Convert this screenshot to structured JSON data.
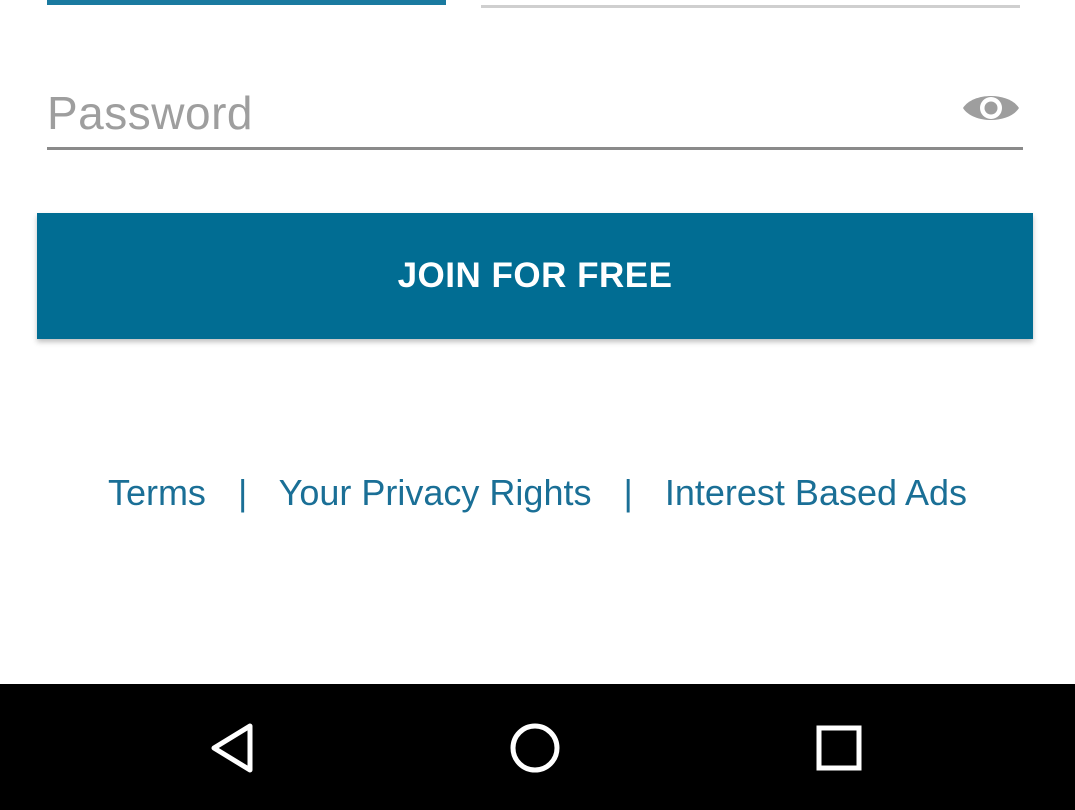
{
  "password_field": {
    "placeholder": "Password",
    "icon": "eye-icon"
  },
  "join_button": {
    "label": "JOIN FOR FREE",
    "color": "#016d93"
  },
  "footer_links": {
    "terms": "Terms",
    "separator": "|",
    "privacy": "Your Privacy Rights",
    "ads": "Interest Based Ads",
    "color": "#1a6f96"
  },
  "nav_bar": {
    "back_icon": "back-triangle-icon",
    "home_icon": "home-circle-icon",
    "recents_icon": "recents-square-icon"
  }
}
